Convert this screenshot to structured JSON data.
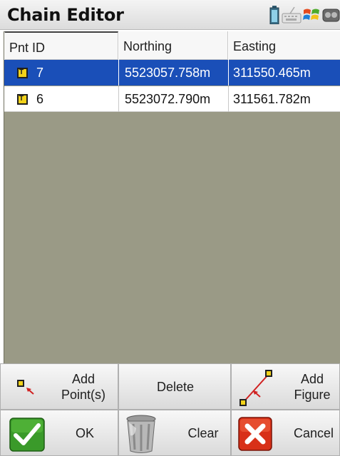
{
  "window": {
    "title": "Chain Editor"
  },
  "tray": {
    "icons": [
      "battery-icon",
      "keyboard-icon",
      "windows-start-icon",
      "connection-icon"
    ]
  },
  "table": {
    "columns": [
      "Pnt ID",
      "Northing",
      "Easting"
    ],
    "rows": [
      {
        "type": "T",
        "id": "7",
        "northing": "5523057.758m",
        "easting": "311550.465m",
        "selected": true
      },
      {
        "type": "T",
        "id": "6",
        "northing": "5523072.790m",
        "easting": "311561.782m",
        "selected": false
      }
    ]
  },
  "buttons": {
    "add_points": {
      "line1": "Add",
      "line2": "Point(s)"
    },
    "delete": {
      "label": "Delete"
    },
    "add_figure": {
      "line1": "Add",
      "line2": "Figure"
    },
    "ok": {
      "label": "OK"
    },
    "clear": {
      "label": "Clear"
    },
    "cancel": {
      "label": "Cancel"
    }
  },
  "colors": {
    "selected_row": "#1a4fb8",
    "table_background": "#9a9a86",
    "ok_green": "#3a9a2a",
    "cancel_red": "#d83018"
  }
}
